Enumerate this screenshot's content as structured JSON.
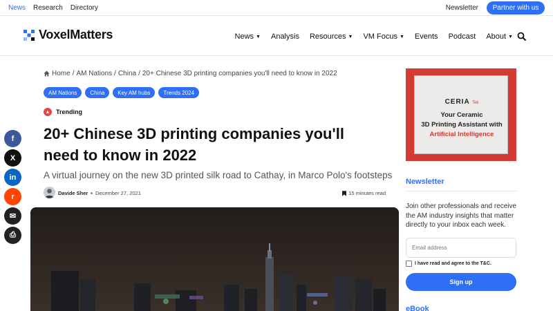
{
  "topbar": {
    "links": [
      "News",
      "Research",
      "Directory"
    ],
    "active": "News",
    "newsletter": "Newsletter",
    "partner": "Partner with us"
  },
  "header": {
    "logo": "VoxelMatters",
    "nav": [
      {
        "label": "News",
        "dropdown": true
      },
      {
        "label": "Analysis",
        "dropdown": false
      },
      {
        "label": "Resources",
        "dropdown": true
      },
      {
        "label": "VM Focus",
        "dropdown": true
      },
      {
        "label": "Events",
        "dropdown": false
      },
      {
        "label": "Podcast",
        "dropdown": false
      },
      {
        "label": "About",
        "dropdown": true
      }
    ],
    "search_icon": "search-icon"
  },
  "social": [
    {
      "name": "facebook",
      "glyph": "f",
      "color": "#3b5998"
    },
    {
      "name": "x",
      "glyph": "X",
      "color": "#111111"
    },
    {
      "name": "linkedin",
      "glyph": "in",
      "color": "#0a66c2"
    },
    {
      "name": "reddit",
      "glyph": "r",
      "color": "#ff4500"
    },
    {
      "name": "email",
      "glyph": "✉",
      "color": "#222222"
    },
    {
      "name": "print",
      "glyph": "⎙",
      "color": "#222222"
    }
  ],
  "article": {
    "breadcrumb": {
      "home": "Home",
      "items": [
        "AM Nations",
        "China",
        "20+ Chinese 3D printing companies you'll need to know in 2022"
      ]
    },
    "tags": [
      "AM Nations",
      "China",
      "Key AM hubs",
      "Trends 2024"
    ],
    "trending": "Trending",
    "title": "20+ Chinese 3D printing companies you'll need to know in 2022",
    "subtitle": "A virtual journey on the new 3D printed silk road to Cathay, in Marco Polo's footsteps",
    "author": "Davide Sher",
    "date": "December 27, 2021",
    "read_time": "15 minutes read"
  },
  "sidebar": {
    "ad": {
      "brand": "CERIA",
      "brand_suffix": "Tek",
      "line1": "Your Ceramic",
      "line2": "3D Printing Assistant with",
      "line3": "Artificial Intelligence"
    },
    "newsletter": {
      "title": "Newsletter",
      "text": "Join other professionals and receive the AM industry insights that matter directly to your inbox each week.",
      "email_placeholder": "Email address",
      "agree": "I have read and agree to the T&C.",
      "signup": "Sign up"
    },
    "ebook": "eBook"
  },
  "colors": {
    "accent": "#2f6ff5",
    "trending": "#e64545",
    "ad_red": "#d23b33"
  }
}
